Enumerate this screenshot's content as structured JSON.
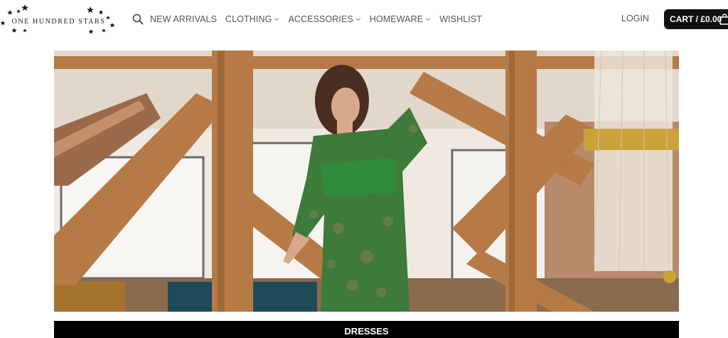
{
  "brand": {
    "name": "ONE HUNDRED STARS"
  },
  "nav": {
    "items": [
      {
        "label": "NEW ARRIVALS",
        "has_dropdown": false
      },
      {
        "label": "CLOTHING",
        "has_dropdown": true
      },
      {
        "label": "ACCESSORIES",
        "has_dropdown": true
      },
      {
        "label": "HOMEWARE",
        "has_dropdown": true
      },
      {
        "label": "WISHLIST",
        "has_dropdown": false
      }
    ],
    "search_icon": "search-icon",
    "login_label": "LOGIN",
    "cart_label": "CART / £0.00",
    "cart_icon": "shopping-bag-icon"
  },
  "hero": {
    "description_icon": "hero-photo"
  },
  "banner": {
    "label": "DRESSES"
  },
  "colors": {
    "cart_bg": "#111111",
    "banner_bg": "#000000",
    "nav_text": "#555555"
  }
}
